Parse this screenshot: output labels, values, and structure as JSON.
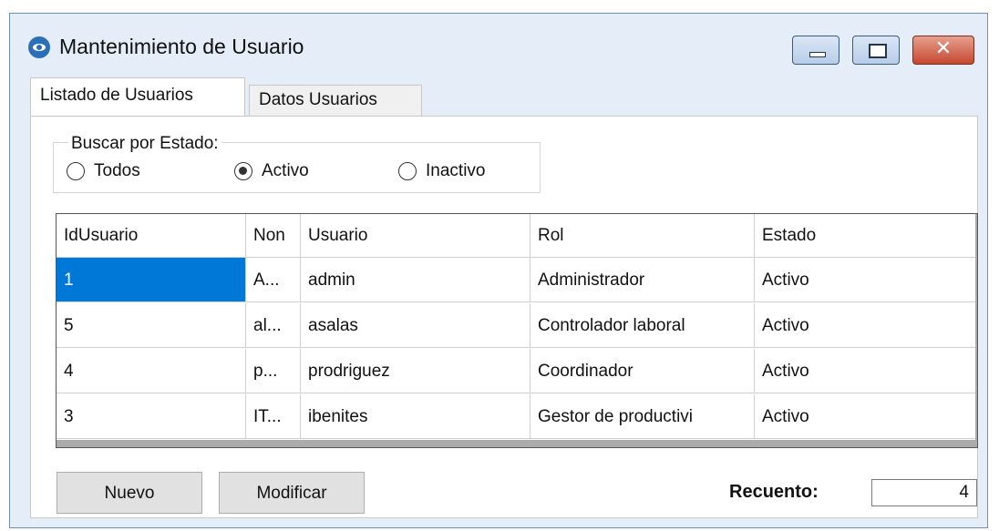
{
  "window": {
    "title": "Mantenimiento de Usuario",
    "close_glyph": "✕",
    "accent": "#2a6fb8",
    "icon": "eye-icon"
  },
  "tabs": [
    {
      "label": "Listado de Usuarios",
      "active": true
    },
    {
      "label": "Datos Usuarios",
      "active": false
    }
  ],
  "filter": {
    "legend": "Buscar por Estado:",
    "options": [
      {
        "label": "Todos",
        "checked": false
      },
      {
        "label": "Activo",
        "checked": true
      },
      {
        "label": "Inactivo",
        "checked": false
      }
    ]
  },
  "grid": {
    "columns": [
      "IdUsuario",
      "Non",
      "Usuario",
      "Rol",
      "Estado"
    ],
    "rows": [
      [
        "1",
        "A...",
        "admin",
        "Administrador",
        "Activo"
      ],
      [
        "5",
        "al...",
        "asalas",
        "Controlador laboral",
        "Activo"
      ],
      [
        "4",
        "p...",
        "prodriguez",
        "Coordinador",
        "Activo"
      ],
      [
        "3",
        "IT...",
        "ibenites",
        "Gestor de productivi",
        "Activo"
      ]
    ],
    "selection_color": "#0078d7"
  },
  "actions": {
    "new_label": "Nuevo",
    "edit_label": "Modificar"
  },
  "count": {
    "label": "Recuento:",
    "value": "4"
  }
}
